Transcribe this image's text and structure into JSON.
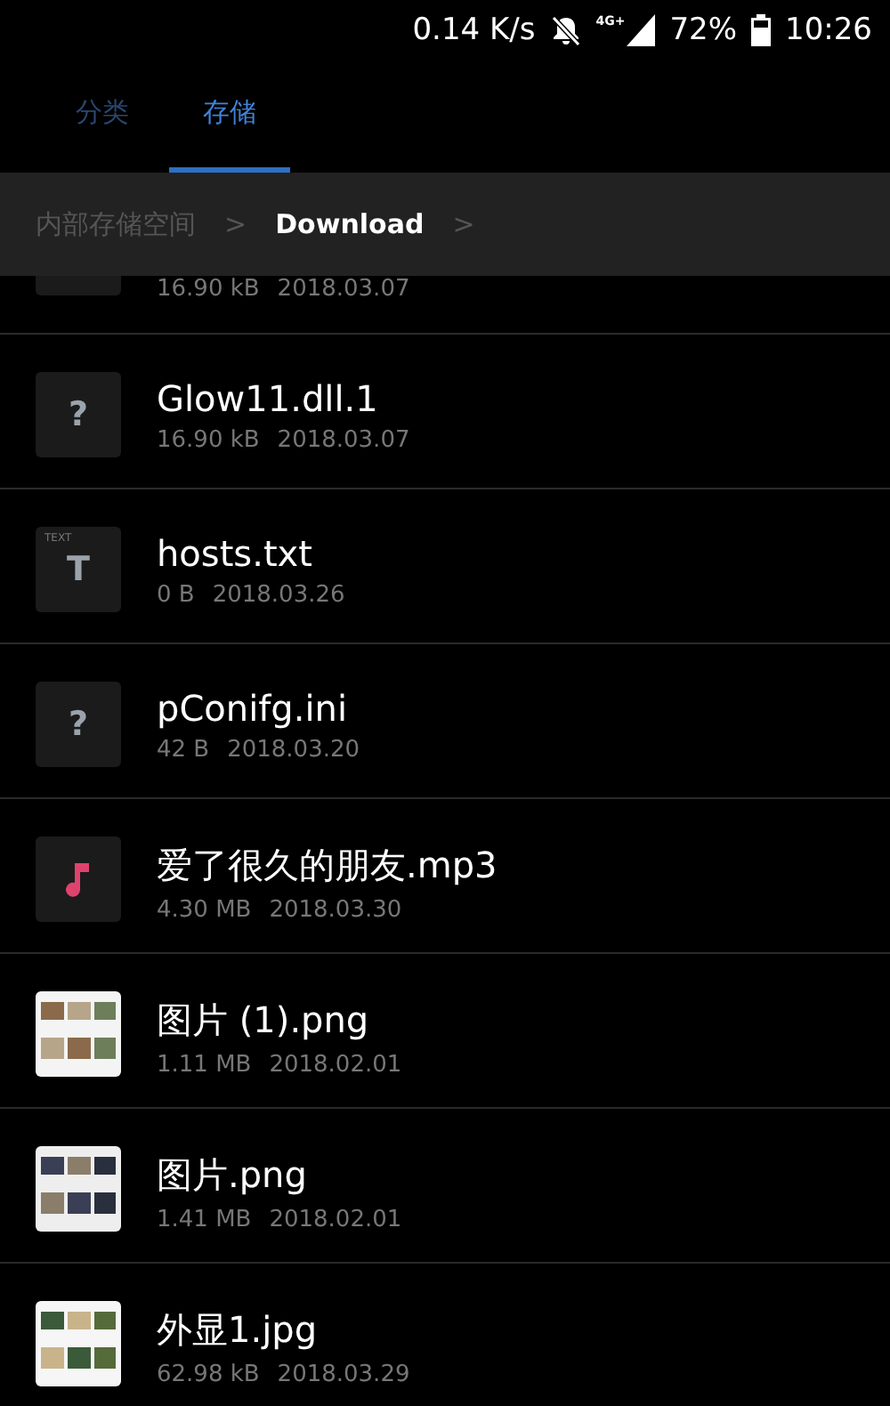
{
  "status_bar": {
    "speed": "0.14 K/s",
    "network": "4G+",
    "battery": "72%",
    "time": "10:26"
  },
  "tabs": [
    {
      "label": "分类",
      "selected": false
    },
    {
      "label": "存储",
      "selected": true
    }
  ],
  "breadcrumb": {
    "items": [
      {
        "label": "内部存储空间",
        "current": false
      },
      {
        "label": "Download",
        "current": true
      }
    ],
    "separator": ">"
  },
  "files": [
    {
      "kind": "partial",
      "size": "16.90 kB",
      "date": "2018.03.07"
    },
    {
      "kind": "unknown",
      "glyph": "?",
      "name": "Glow11.dll.1",
      "size": "16.90 kB",
      "date": "2018.03.07"
    },
    {
      "kind": "text",
      "glyph": "T",
      "icon_label": "TEXT",
      "name": "hosts.txt",
      "size": "0 B",
      "date": "2018.03.26"
    },
    {
      "kind": "unknown",
      "glyph": "?",
      "name": "pConifg.ini",
      "size": "42 B",
      "date": "2018.03.20"
    },
    {
      "kind": "audio",
      "name": "爱了很久的朋友.mp3",
      "size": "4.30 MB",
      "date": "2018.03.30"
    },
    {
      "name": "图片 (1).png",
      "size": "1.11 MB",
      "date": "2018.02.01"
    },
    {
      "name": "图片.png",
      "size": "1.41 MB",
      "date": "2018.02.01"
    },
    {
      "name": "外显1.jpg",
      "size": "62.98 kB",
      "date": "2018.03.29"
    }
  ]
}
